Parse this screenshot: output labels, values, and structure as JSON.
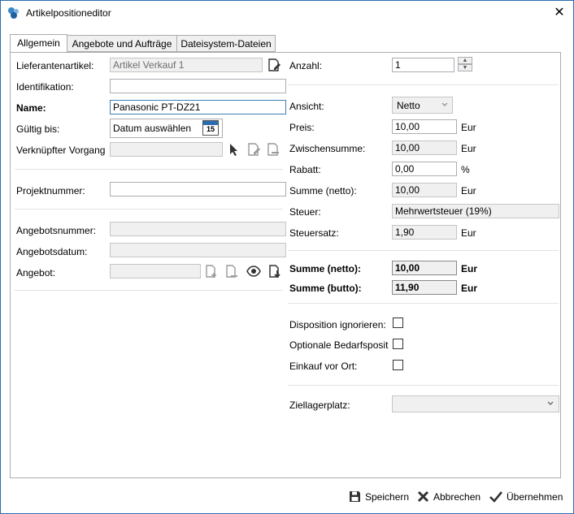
{
  "window": {
    "title": "Artikelpositioneditor",
    "close_glyph": "✕"
  },
  "tabs": [
    {
      "label": "Allgemein"
    },
    {
      "label": "Angebote und Aufträge"
    },
    {
      "label": "Dateisystem-Dateien"
    }
  ],
  "left": {
    "lieferantenartikel": {
      "label": "Lieferantenartikel:",
      "value": "Artikel Verkauf 1"
    },
    "identifikation": {
      "label": "Identifikation:",
      "value": ""
    },
    "name": {
      "label": "Name:",
      "value": "Panasonic PT-DZ21"
    },
    "gueltig": {
      "label": "Gültig bis:",
      "value": "Datum auswählen",
      "cal_day": "15"
    },
    "vorgang": {
      "label": "Verknüpfter Vorgang",
      "value": ""
    },
    "projektnummer": {
      "label": "Projektnummer:",
      "value": ""
    },
    "angebotsnummer": {
      "label": "Angebotsnummer:",
      "value": ""
    },
    "angebotsdatum": {
      "label": "Angebotsdatum:",
      "value": ""
    },
    "angebot": {
      "label": "Angebot:",
      "value": ""
    }
  },
  "right": {
    "anzahl": {
      "label": "Anzahl:",
      "value": "1"
    },
    "ansicht": {
      "label": "Ansicht:",
      "value": "Netto"
    },
    "preis": {
      "label": "Preis:",
      "value": "10,00",
      "unit": "Eur"
    },
    "zwischensumme": {
      "label": "Zwischensumme:",
      "value": "10,00",
      "unit": "Eur"
    },
    "rabatt": {
      "label": "Rabatt:",
      "value": "0,00",
      "unit": "%"
    },
    "summe_netto": {
      "label": "Summe (netto):",
      "value": "10,00",
      "unit": "Eur"
    },
    "steuer": {
      "label": "Steuer:",
      "value": "Mehrwertsteuer (19%)"
    },
    "steuersatz": {
      "label": "Steuersatz:",
      "value": "1,90",
      "unit": "Eur"
    },
    "total_netto": {
      "label": "Summe (netto):",
      "value": "10,00",
      "unit": "Eur"
    },
    "total_brutto": {
      "label": "Summe (butto):",
      "value": "11,90",
      "unit": "Eur"
    },
    "disposition": {
      "label": "Disposition ignorieren:",
      "checked": false
    },
    "optionale": {
      "label": "Optionale Bedarfsposit",
      "checked": false
    },
    "einkauf": {
      "label": "Einkauf vor Ort:",
      "checked": false
    },
    "ziellagerplatz": {
      "label": "Ziellagerplatz:",
      "value": ""
    }
  },
  "footer": {
    "save": "Speichern",
    "cancel": "Abbrechen",
    "apply": "Übernehmen"
  },
  "colors": {
    "accent": "#2b6cb0",
    "focus_border": "#3c7fb1",
    "disabled_bg": "#f0f0f0"
  }
}
